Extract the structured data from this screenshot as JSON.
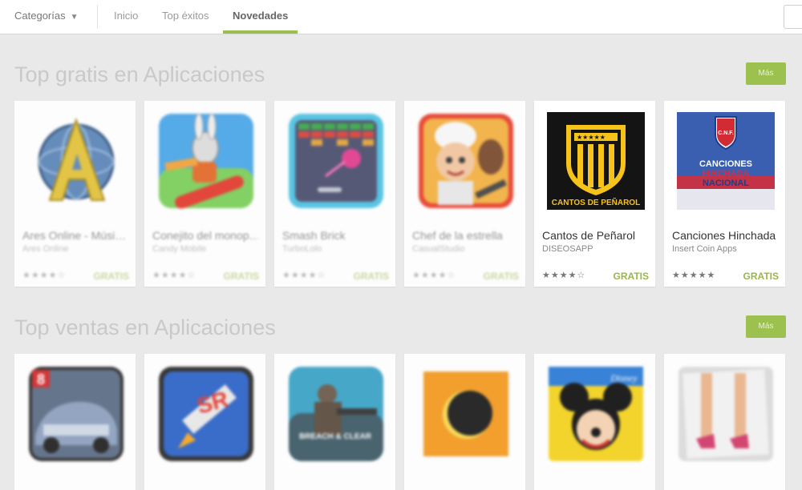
{
  "nav": {
    "categories": "Categorías",
    "tabs": [
      {
        "label": "Inicio"
      },
      {
        "label": "Top éxitos"
      },
      {
        "label": "Novedades"
      }
    ]
  },
  "sections": [
    {
      "title": "Top gratis en Aplicaciones",
      "more": "Más",
      "apps": [
        {
          "name": "Ares Online - Músi…",
          "developer": "Ares Online",
          "price": "GRATIS",
          "rating": 4.5
        },
        {
          "name": "Conejito del monop…",
          "developer": "Candy Mobile",
          "price": "GRATIS",
          "rating": 4
        },
        {
          "name": "Smash Brick",
          "developer": "TurboLolo",
          "price": "GRATIS",
          "rating": 4
        },
        {
          "name": "Chef de la estrella",
          "developer": "CasualStudio",
          "price": "GRATIS",
          "rating": 4
        },
        {
          "name": "Cantos de Peñarol",
          "developer": "DISEOSAPP",
          "price": "GRATIS",
          "rating": 4
        },
        {
          "name": "Canciones Hinchada",
          "developer": "Insert Coin Apps",
          "price": "GRATIS",
          "rating": 4.5
        }
      ]
    },
    {
      "title": "Top ventas en Aplicaciones",
      "more": "Más",
      "apps": [
        {
          "name": "",
          "developer": "",
          "price": "",
          "icon_text": "8"
        },
        {
          "name": "",
          "developer": "",
          "price": "",
          "icon_text": "SR"
        },
        {
          "name": "",
          "developer": "",
          "price": "",
          "icon_text": "BREACH & CLEAR"
        },
        {
          "name": "",
          "developer": "",
          "price": "",
          "icon_text": ""
        },
        {
          "name": "",
          "developer": "",
          "price": "",
          "icon_text": "Disney"
        },
        {
          "name": "",
          "developer": "",
          "price": "",
          "icon_text": ""
        }
      ]
    }
  ],
  "icon_text": {
    "penarol_caption": "CANTOS DE PEÑAROL",
    "hinchada_line1": "CANCIONES",
    "hinchada_line2": "HINCHADA",
    "hinchada_line3": "NACIONAL",
    "nacional_crest": "C.N.F."
  },
  "colors": {
    "accent_green": "#9bbf4f",
    "price_green": "#9ab54a",
    "background": "#e9e9e9"
  }
}
